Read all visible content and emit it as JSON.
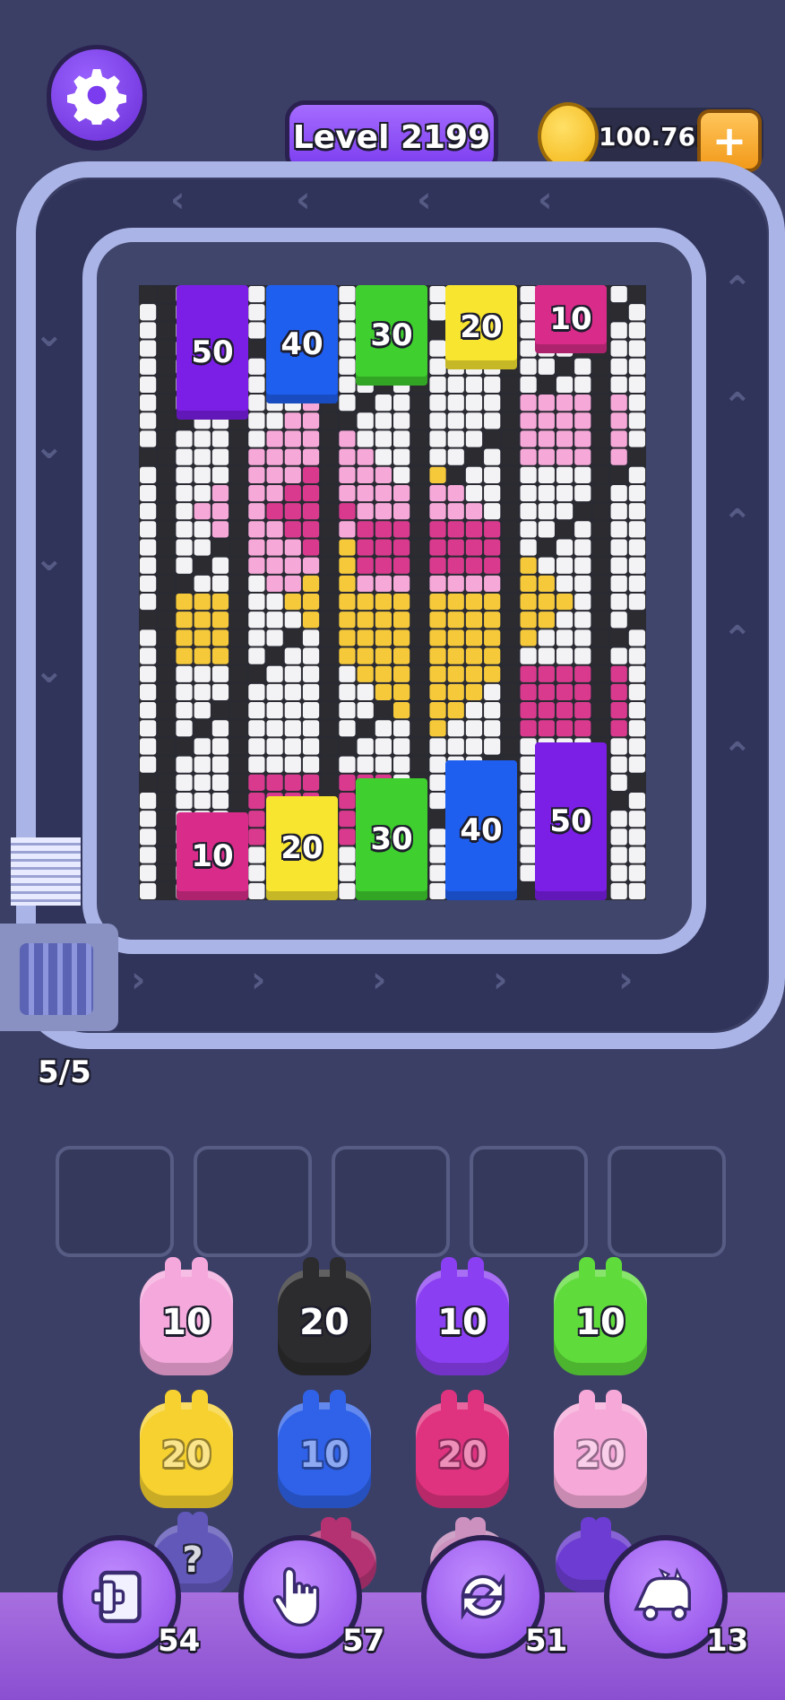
{
  "header": {
    "level_label": "Level 2199",
    "coins": "100.76k"
  },
  "board": {
    "top_blocks": [
      {
        "value": "50",
        "color": "#7b1fe6"
      },
      {
        "value": "40",
        "color": "#1f5ff0"
      },
      {
        "value": "30",
        "color": "#3fcf2e"
      },
      {
        "value": "20",
        "color": "#f7e52f"
      },
      {
        "value": "10",
        "color": "#d92c8a"
      }
    ],
    "bottom_blocks": [
      {
        "value": "10",
        "color": "#d92c8a"
      },
      {
        "value": "20",
        "color": "#f7e52f"
      },
      {
        "value": "30",
        "color": "#3fcf2e"
      },
      {
        "value": "40",
        "color": "#1f5ff0"
      },
      {
        "value": "50",
        "color": "#7b1fe6"
      }
    ]
  },
  "conveyor": {
    "count": "5/5"
  },
  "pigs": {
    "row1": [
      {
        "value": "10",
        "color": "#f5a8dc"
      },
      {
        "value": "20",
        "color": "#2c2c2e"
      },
      {
        "value": "10",
        "color": "#8b3ff2"
      },
      {
        "value": "10",
        "color": "#5fdc3b"
      }
    ],
    "row2": [
      {
        "value": "20",
        "color": "#f6d12f"
      },
      {
        "value": "10",
        "color": "#2f62e8"
      },
      {
        "value": "20",
        "color": "#e0337f"
      },
      {
        "value": "20",
        "color": "#f6a9d8"
      }
    ],
    "row3_hint": "?"
  },
  "tools": [
    {
      "name": "add-slot",
      "count": "54",
      "icon": "add-slot-icon"
    },
    {
      "name": "hand",
      "count": "57",
      "icon": "hand-icon"
    },
    {
      "name": "shuffle",
      "count": "51",
      "icon": "shuffle-icon"
    },
    {
      "name": "magnet",
      "count": "13",
      "icon": "pig-car-icon"
    }
  ]
}
